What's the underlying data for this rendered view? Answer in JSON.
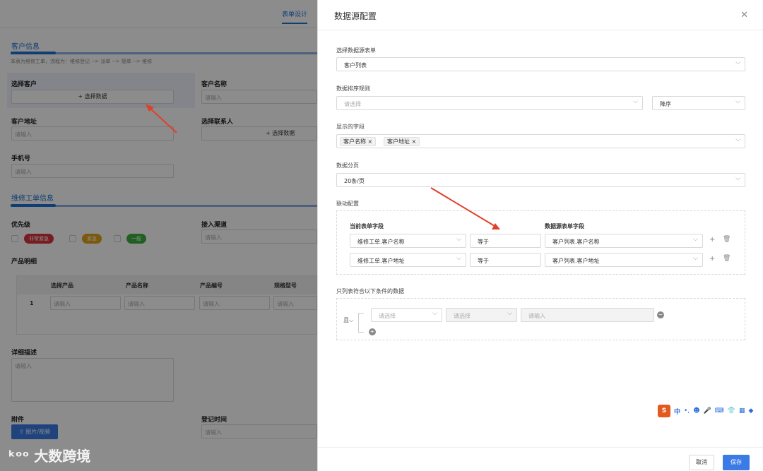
{
  "background_form": {
    "tab": "表单设计",
    "section1": "客户信息",
    "hint": "本表为维修工单，流程为：维修登记 --> 派单 --> 接单 --> 维修",
    "select_customer_label": "选择客户",
    "select_data_btn": "+ 选择数据",
    "customer_name_label": "客户名称",
    "customer_address_label": "客户地址",
    "select_contact_label": "选择联系人",
    "phone_label": "手机号",
    "placeholder": "请输入",
    "section2": "维修工单信息",
    "priority_label": "优先级",
    "priority_options": [
      "非常紧急",
      "紧急",
      "一般"
    ],
    "priority_colors": [
      "#d9363e",
      "#e0a21a",
      "#3fae3f"
    ],
    "channel_label": "接入渠道",
    "product_detail_label": "产品明细",
    "product_table_headers": [
      "选择产品",
      "产品名称",
      "产品编号",
      "规格型号"
    ],
    "product_row_index": "1",
    "description_label": "详细描述",
    "attachment_label": "附件",
    "upload_btn": "图片/视频",
    "register_time_label": "登记时间"
  },
  "drawer": {
    "title": "数据源配置",
    "close_icon": "close-icon",
    "source_form_label": "选择数据源表单",
    "source_form_value": "客户列表",
    "sort_label": "数据排序规则",
    "sort_field_placeholder": "请选择",
    "sort_order_value": "降序",
    "display_fields_label": "显示的字段",
    "display_fields": [
      "客户名称",
      "客户地址"
    ],
    "paging_label": "数据分页",
    "paging_value": "20条/页",
    "linkage_label": "联动配置",
    "linkage_col_current": "当前表单字段",
    "linkage_col_source": "数据源表单字段",
    "linkage_rows": [
      {
        "current": "维修工单.客户名称",
        "op": "等于",
        "source": "客户列表.客户名称"
      },
      {
        "current": "维修工单.客户地址",
        "op": "等于",
        "source": "客户列表.客户地址"
      }
    ],
    "filter_label": "只列表符合以下条件的数据",
    "filter_conj": "且",
    "filter_field_placeholder": "请选择",
    "filter_op_placeholder": "请选择",
    "filter_value_placeholder": "请输入",
    "cancel_btn": "取消",
    "save_btn": "保存"
  },
  "ime": {
    "logo": "S",
    "lang": "中"
  },
  "watermark": "大数跨境"
}
